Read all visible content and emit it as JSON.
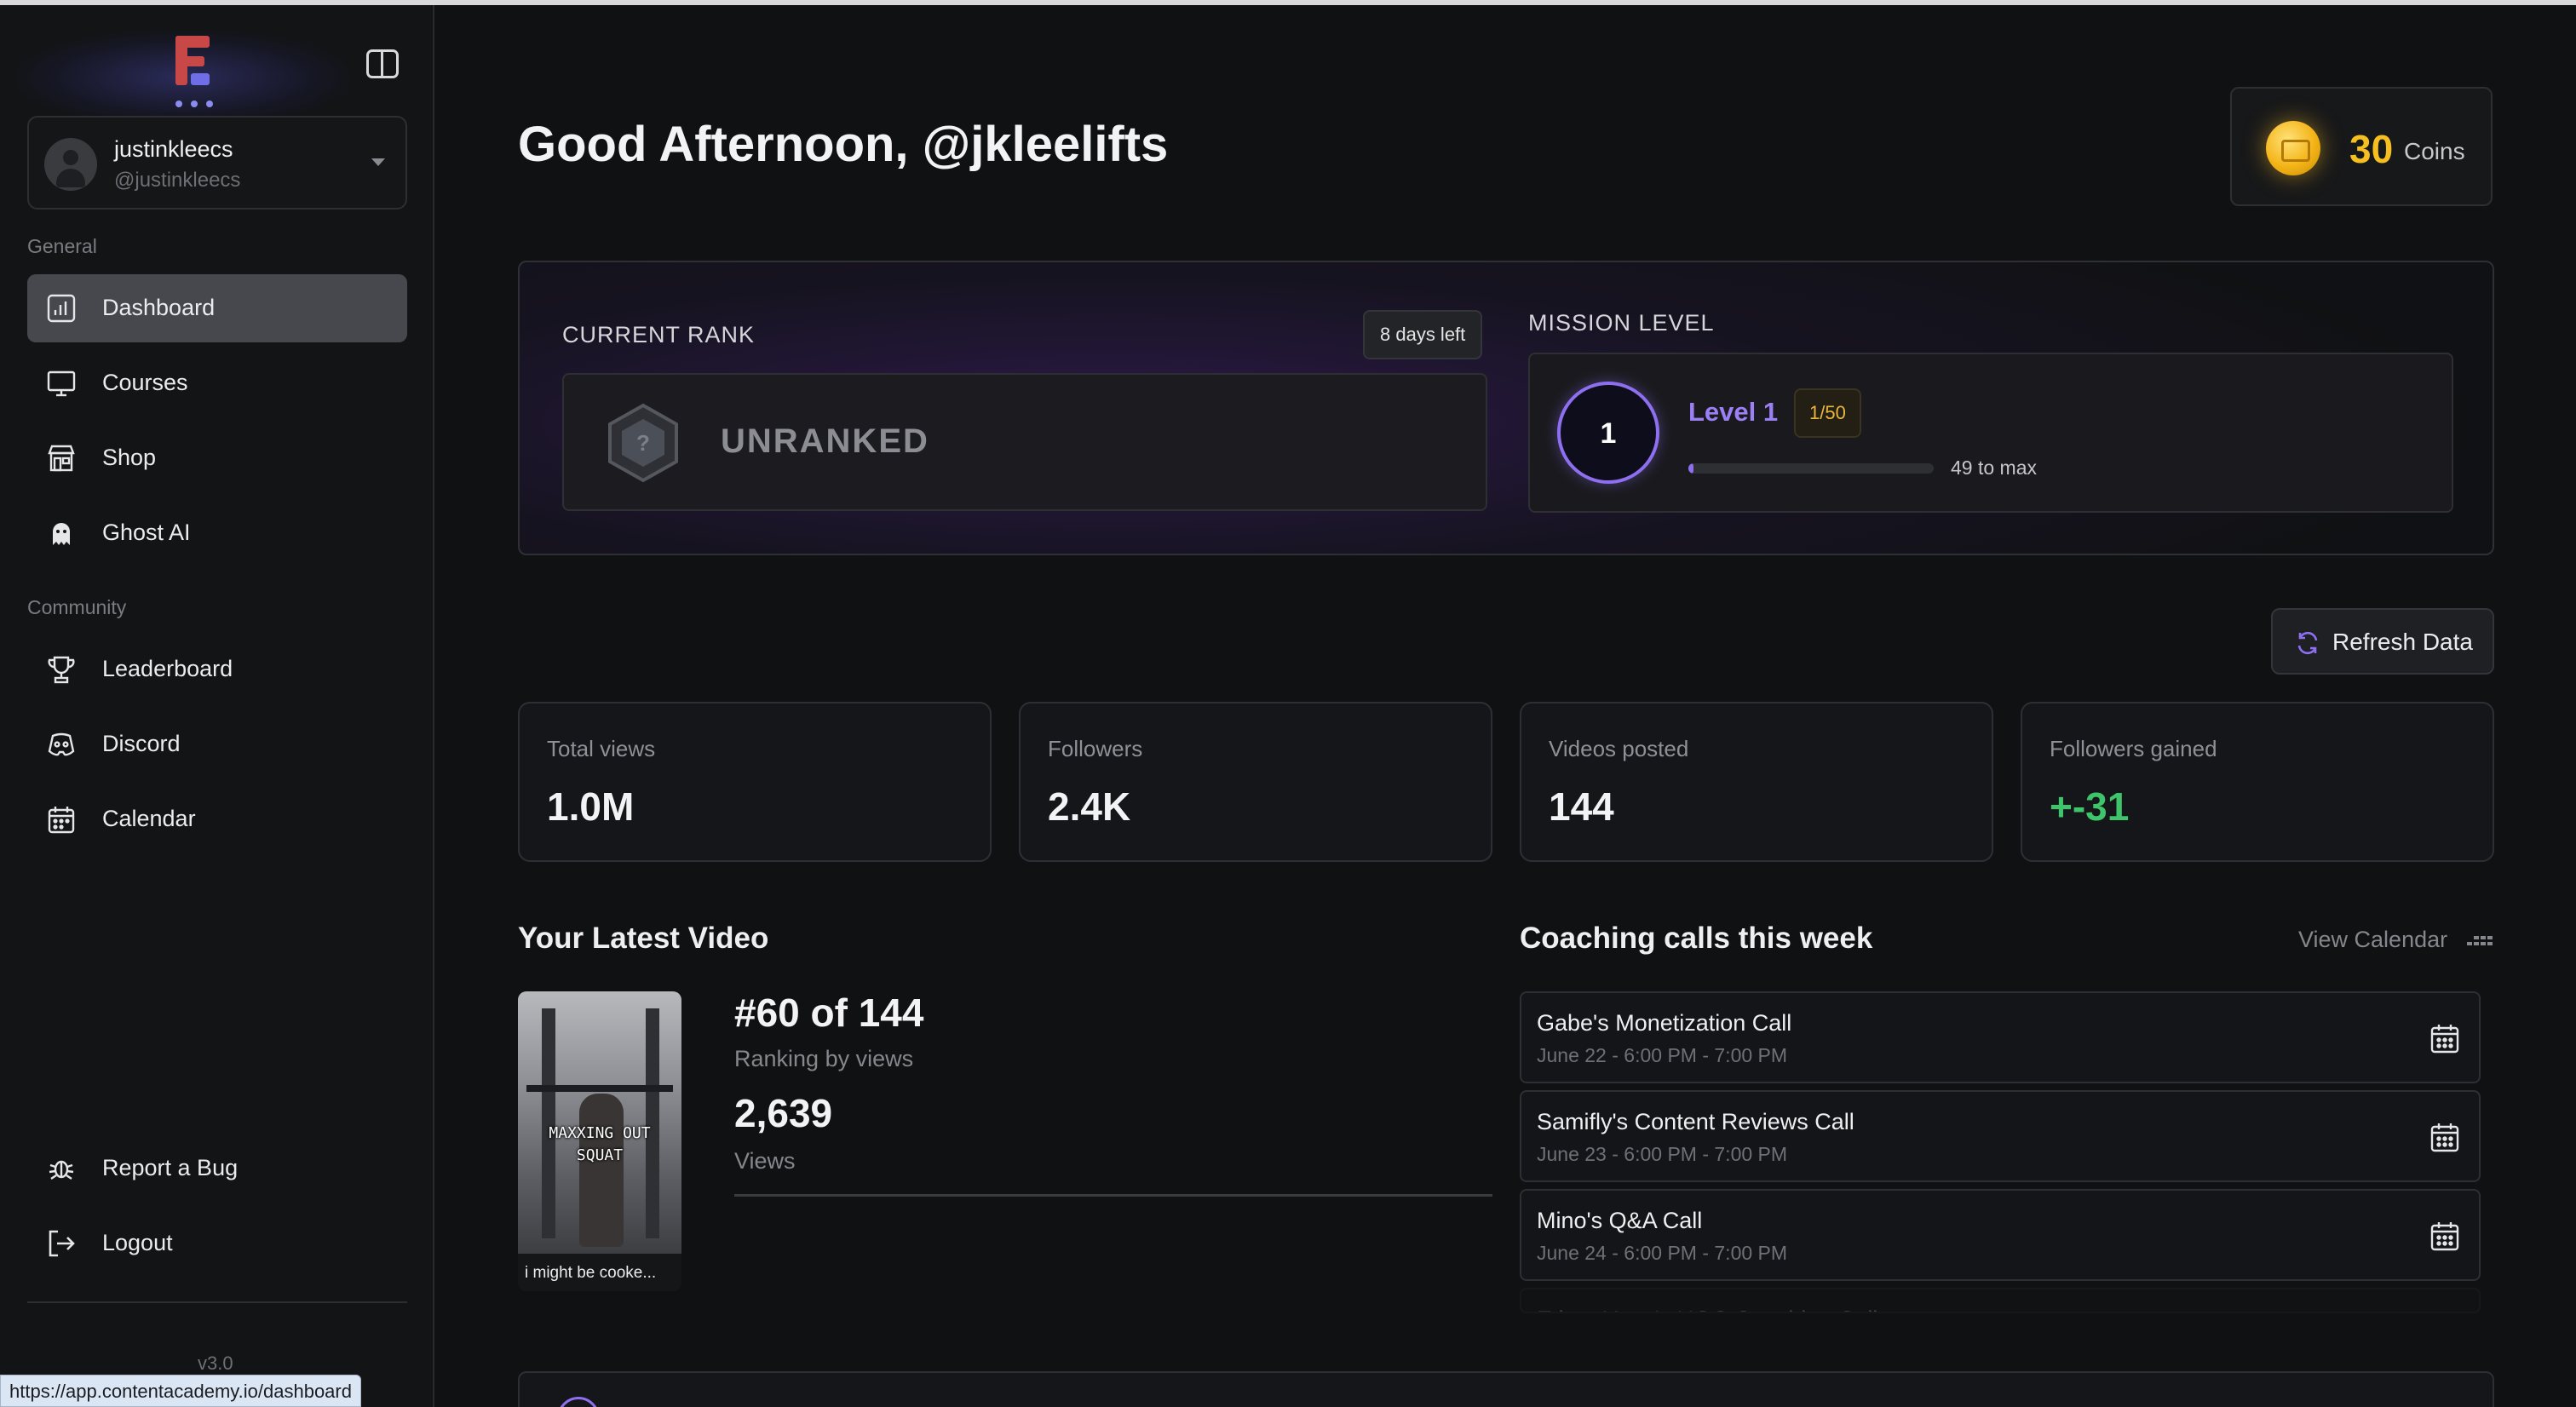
{
  "app": {
    "url": "https://app.contentacademy.io/dashboard",
    "version": "v3.0"
  },
  "user": {
    "name": "justinkleecs",
    "handle": "@justinkleecs"
  },
  "sidebar": {
    "general_label": "General",
    "community_label": "Community",
    "general_items": [
      {
        "label": "Dashboard",
        "icon": "bar-chart-icon",
        "active": true
      },
      {
        "label": "Courses",
        "icon": "monitor-icon"
      },
      {
        "label": "Shop",
        "icon": "store-icon"
      },
      {
        "label": "Ghost AI",
        "icon": "ghost-icon"
      }
    ],
    "community_items": [
      {
        "label": "Leaderboard",
        "icon": "trophy-icon"
      },
      {
        "label": "Discord",
        "icon": "discord-icon"
      },
      {
        "label": "Calendar",
        "icon": "calendar-icon"
      }
    ],
    "bottom_items": [
      {
        "label": "Report a Bug",
        "icon": "bug-icon"
      },
      {
        "label": "Logout",
        "icon": "logout-icon"
      }
    ]
  },
  "header": {
    "greeting": "Good Afternoon, @jkleelifts",
    "coins_count": "30",
    "coins_label": "Coins"
  },
  "rank": {
    "title": "CURRENT RANK",
    "days_left": "8 days left",
    "value": "UNRANKED"
  },
  "mission": {
    "title": "MISSION LEVEL",
    "level_number": "1",
    "level_name": "Level 1",
    "level_badge": "1/50",
    "progress_label": "49 to max",
    "progress_fraction": 0.02
  },
  "refresh_label": "Refresh Data",
  "stats": [
    {
      "label": "Total views",
      "value": "1.0M"
    },
    {
      "label": "Followers",
      "value": "2.4K"
    },
    {
      "label": "Videos posted",
      "value": "144"
    },
    {
      "label": "Followers gained",
      "value": "+-31",
      "color": "#3ec46a"
    }
  ],
  "latest_video": {
    "title": "Your Latest Video",
    "thumb_overlay": "MAXXING OUT\nSQUAT",
    "thumb_caption": "i might be cooke...",
    "rank": "#60 of 144",
    "rank_label": "Ranking by views",
    "views": "2,639",
    "views_label": "Views"
  },
  "coaching": {
    "title": "Coaching calls this week",
    "view_calendar": "View Calendar",
    "calls": [
      {
        "title": "Gabe's Monetization Call",
        "time": "June 22 - 6:00 PM - 7:00 PM"
      },
      {
        "title": "Samifly's Content Reviews Call",
        "time": "June 23 - 6:00 PM - 7:00 PM"
      },
      {
        "title": "Mino's Q&A Call",
        "time": "June 24 - 6:00 PM - 7:00 PM"
      },
      {
        "title": "Ethan Yang's UGC Coaching Call",
        "time": ""
      }
    ]
  },
  "colors": {
    "accent_purple": "#8d6ff0",
    "coin_gold": "#f5bf21",
    "positive_green": "#3ec46a"
  }
}
